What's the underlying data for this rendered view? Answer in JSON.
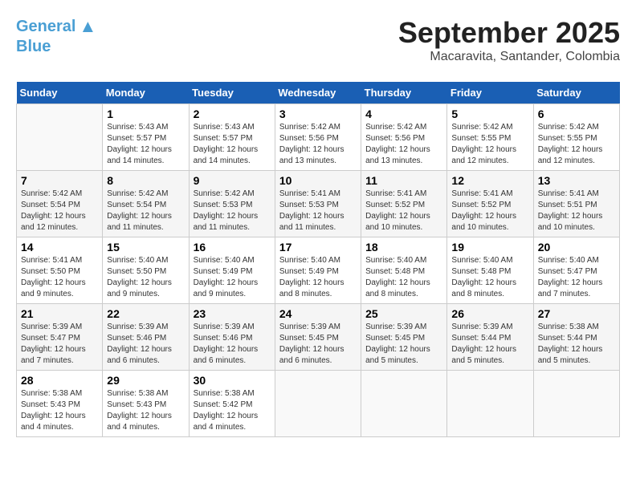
{
  "logo": {
    "line1": "General",
    "line2": "Blue"
  },
  "header": {
    "month_year": "September 2025",
    "location": "Macaravita, Santander, Colombia"
  },
  "weekdays": [
    "Sunday",
    "Monday",
    "Tuesday",
    "Wednesday",
    "Thursday",
    "Friday",
    "Saturday"
  ],
  "weeks": [
    [
      {
        "day": "",
        "info": ""
      },
      {
        "day": "1",
        "info": "Sunrise: 5:43 AM\nSunset: 5:57 PM\nDaylight: 12 hours\nand 14 minutes."
      },
      {
        "day": "2",
        "info": "Sunrise: 5:43 AM\nSunset: 5:57 PM\nDaylight: 12 hours\nand 14 minutes."
      },
      {
        "day": "3",
        "info": "Sunrise: 5:42 AM\nSunset: 5:56 PM\nDaylight: 12 hours\nand 13 minutes."
      },
      {
        "day": "4",
        "info": "Sunrise: 5:42 AM\nSunset: 5:56 PM\nDaylight: 12 hours\nand 13 minutes."
      },
      {
        "day": "5",
        "info": "Sunrise: 5:42 AM\nSunset: 5:55 PM\nDaylight: 12 hours\nand 12 minutes."
      },
      {
        "day": "6",
        "info": "Sunrise: 5:42 AM\nSunset: 5:55 PM\nDaylight: 12 hours\nand 12 minutes."
      }
    ],
    [
      {
        "day": "7",
        "info": "Sunrise: 5:42 AM\nSunset: 5:54 PM\nDaylight: 12 hours\nand 12 minutes."
      },
      {
        "day": "8",
        "info": "Sunrise: 5:42 AM\nSunset: 5:54 PM\nDaylight: 12 hours\nand 11 minutes."
      },
      {
        "day": "9",
        "info": "Sunrise: 5:42 AM\nSunset: 5:53 PM\nDaylight: 12 hours\nand 11 minutes."
      },
      {
        "day": "10",
        "info": "Sunrise: 5:41 AM\nSunset: 5:53 PM\nDaylight: 12 hours\nand 11 minutes."
      },
      {
        "day": "11",
        "info": "Sunrise: 5:41 AM\nSunset: 5:52 PM\nDaylight: 12 hours\nand 10 minutes."
      },
      {
        "day": "12",
        "info": "Sunrise: 5:41 AM\nSunset: 5:52 PM\nDaylight: 12 hours\nand 10 minutes."
      },
      {
        "day": "13",
        "info": "Sunrise: 5:41 AM\nSunset: 5:51 PM\nDaylight: 12 hours\nand 10 minutes."
      }
    ],
    [
      {
        "day": "14",
        "info": "Sunrise: 5:41 AM\nSunset: 5:50 PM\nDaylight: 12 hours\nand 9 minutes."
      },
      {
        "day": "15",
        "info": "Sunrise: 5:40 AM\nSunset: 5:50 PM\nDaylight: 12 hours\nand 9 minutes."
      },
      {
        "day": "16",
        "info": "Sunrise: 5:40 AM\nSunset: 5:49 PM\nDaylight: 12 hours\nand 9 minutes."
      },
      {
        "day": "17",
        "info": "Sunrise: 5:40 AM\nSunset: 5:49 PM\nDaylight: 12 hours\nand 8 minutes."
      },
      {
        "day": "18",
        "info": "Sunrise: 5:40 AM\nSunset: 5:48 PM\nDaylight: 12 hours\nand 8 minutes."
      },
      {
        "day": "19",
        "info": "Sunrise: 5:40 AM\nSunset: 5:48 PM\nDaylight: 12 hours\nand 8 minutes."
      },
      {
        "day": "20",
        "info": "Sunrise: 5:40 AM\nSunset: 5:47 PM\nDaylight: 12 hours\nand 7 minutes."
      }
    ],
    [
      {
        "day": "21",
        "info": "Sunrise: 5:39 AM\nSunset: 5:47 PM\nDaylight: 12 hours\nand 7 minutes."
      },
      {
        "day": "22",
        "info": "Sunrise: 5:39 AM\nSunset: 5:46 PM\nDaylight: 12 hours\nand 6 minutes."
      },
      {
        "day": "23",
        "info": "Sunrise: 5:39 AM\nSunset: 5:46 PM\nDaylight: 12 hours\nand 6 minutes."
      },
      {
        "day": "24",
        "info": "Sunrise: 5:39 AM\nSunset: 5:45 PM\nDaylight: 12 hours\nand 6 minutes."
      },
      {
        "day": "25",
        "info": "Sunrise: 5:39 AM\nSunset: 5:45 PM\nDaylight: 12 hours\nand 5 minutes."
      },
      {
        "day": "26",
        "info": "Sunrise: 5:39 AM\nSunset: 5:44 PM\nDaylight: 12 hours\nand 5 minutes."
      },
      {
        "day": "27",
        "info": "Sunrise: 5:38 AM\nSunset: 5:44 PM\nDaylight: 12 hours\nand 5 minutes."
      }
    ],
    [
      {
        "day": "28",
        "info": "Sunrise: 5:38 AM\nSunset: 5:43 PM\nDaylight: 12 hours\nand 4 minutes."
      },
      {
        "day": "29",
        "info": "Sunrise: 5:38 AM\nSunset: 5:43 PM\nDaylight: 12 hours\nand 4 minutes."
      },
      {
        "day": "30",
        "info": "Sunrise: 5:38 AM\nSunset: 5:42 PM\nDaylight: 12 hours\nand 4 minutes."
      },
      {
        "day": "",
        "info": ""
      },
      {
        "day": "",
        "info": ""
      },
      {
        "day": "",
        "info": ""
      },
      {
        "day": "",
        "info": ""
      }
    ]
  ]
}
